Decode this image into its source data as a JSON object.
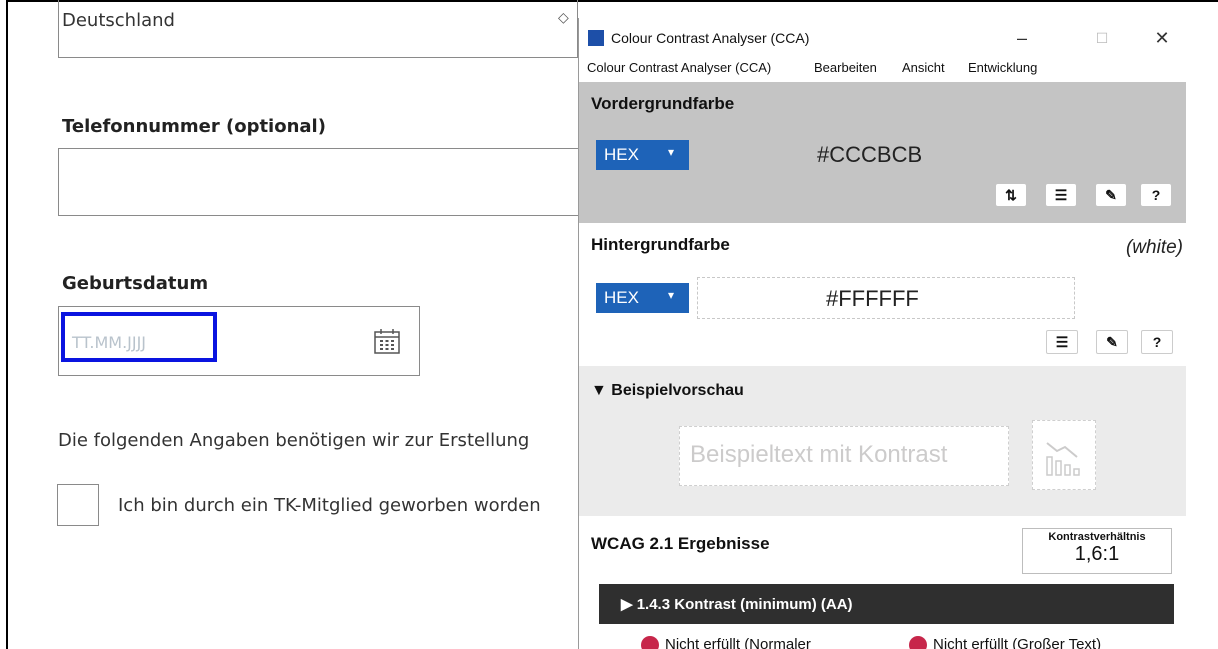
{
  "form": {
    "country_value": "Deutschland",
    "phone_label": "Telefonnummer (optional)",
    "birth_label": "Geburtsdatum",
    "date_placeholder": "TT.MM.JJJJ",
    "info_text": "Die folgenden Angaben benötigen wir zur Erstellung",
    "checkbox_label": "Ich bin durch ein TK-Mitglied geworben worden"
  },
  "cca": {
    "title": "Colour Contrast Analyser (CCA)",
    "window_buttons": {
      "minimize": "–",
      "maximize": "☐",
      "close": "✕"
    },
    "menu": [
      "Colour Contrast Analyser (CCA)",
      "Bearbeiten",
      "Ansicht",
      "Entwicklung"
    ],
    "foreground": {
      "title": "Vordergrundfarbe",
      "format": "HEX",
      "value": "#CCCBCB",
      "buttons": [
        "⇅",
        "☰",
        "✎",
        "?"
      ]
    },
    "background": {
      "title": "Hintergrundfarbe",
      "name": "(white)",
      "format": "HEX",
      "value": "#FFFFFF",
      "buttons": [
        "☰",
        "✎",
        "?"
      ]
    },
    "preview": {
      "title": "▼ Beispielvorschau",
      "sample_text": "Beispieltext mit Kontrast"
    },
    "wcag": {
      "title": "WCAG 2.1 Ergebnisse",
      "ratio_label": "Kontrastverhältnis",
      "ratio_value": "1,6:1",
      "criterion": "▶  1.4.3 Kontrast (minimum) (AA)",
      "result_normal": "Nicht erfüllt (Normaler",
      "result_large": "Nicht erfüllt (Großer Text)"
    },
    "colors": {
      "hex_select": "#1e63b8",
      "foreground_bg": "#c4c4c4",
      "preview_text": "#cccbcb",
      "fail": "#c7264a",
      "focus_outline": "#0a14e0"
    }
  }
}
